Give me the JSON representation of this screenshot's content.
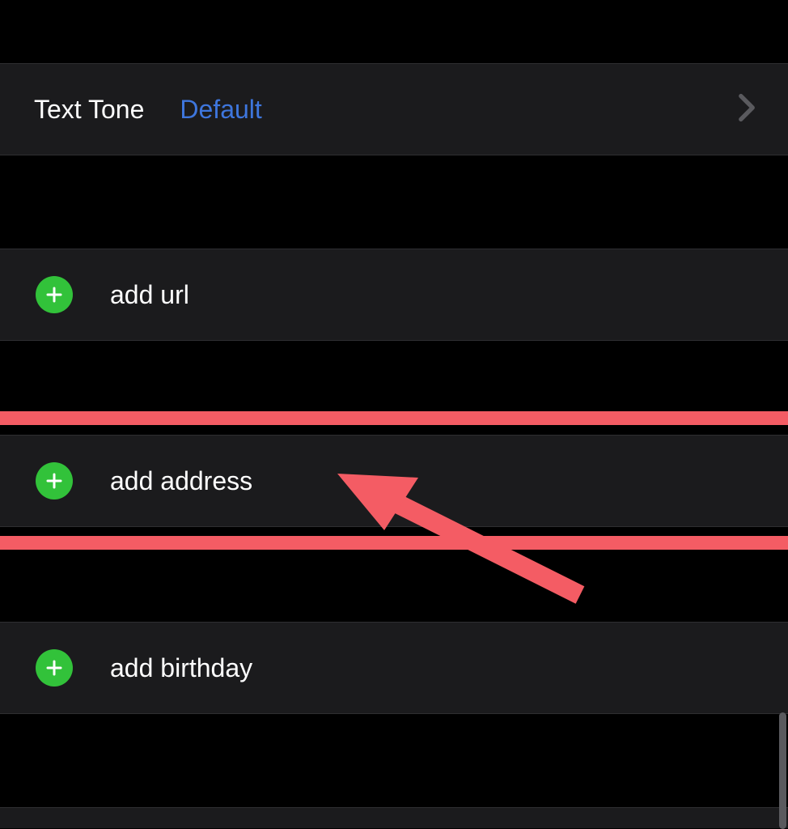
{
  "textTone": {
    "label": "Text Tone",
    "value": "Default"
  },
  "rows": {
    "addUrl": "add url",
    "addAddress": "add address",
    "addBirthday": "add birthday"
  },
  "annotation": {
    "type": "arrow",
    "target": "add-address-row",
    "color": "#f45c64"
  }
}
